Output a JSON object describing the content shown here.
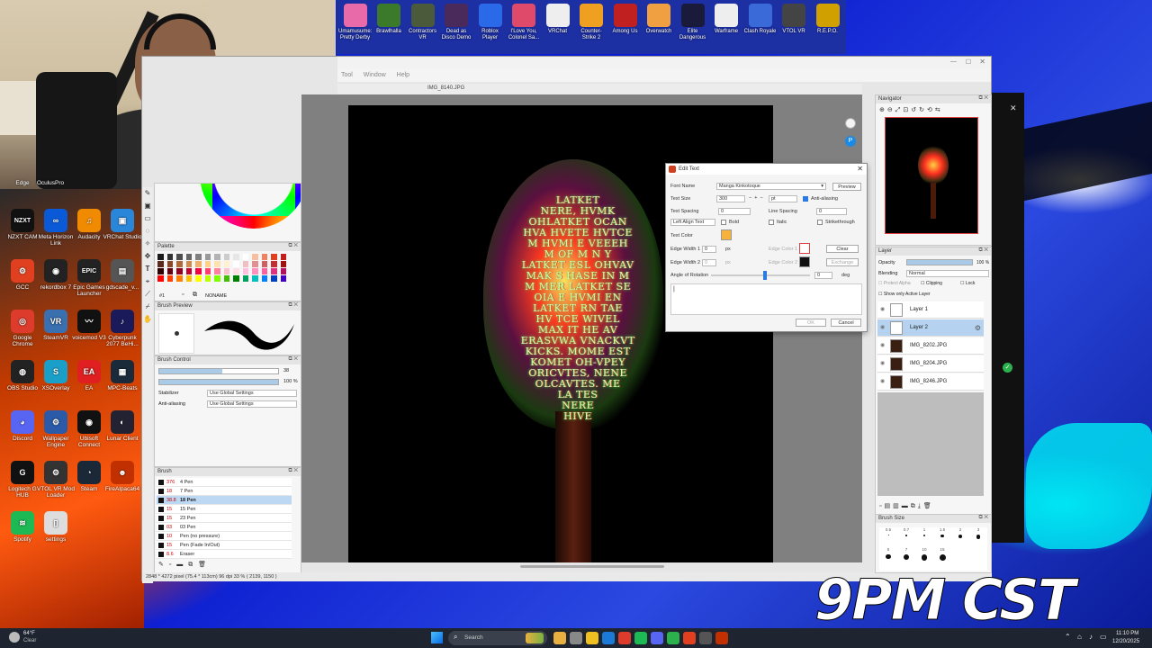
{
  "desktop": {
    "left_icons": [
      {
        "label": "Edge",
        "color": "#1a7ad6"
      },
      {
        "label": "OculusPro",
        "color": "#333333"
      },
      {
        "label": "NZXT CAM",
        "color": "#111111",
        "glyph": "NZXT"
      },
      {
        "label": "Meta Horizon Link",
        "color": "#0a5ad8",
        "glyph": "∞"
      },
      {
        "label": "Audacity",
        "color": "#f08a00",
        "glyph": "♫"
      },
      {
        "label": "VRChat Studio",
        "color": "#2a86d8",
        "glyph": "▣"
      },
      {
        "label": "GCC",
        "color": "#e04020",
        "glyph": "⚙"
      },
      {
        "label": "rekordbox 7",
        "color": "#222222",
        "glyph": "◉"
      },
      {
        "label": "Epic Games Launcher",
        "color": "#222222",
        "glyph": "EPIC"
      },
      {
        "label": "gdscade_v...",
        "color": "#555555",
        "glyph": "▤"
      },
      {
        "label": "Google Chrome",
        "color": "#dd3b2c",
        "glyph": "◎"
      },
      {
        "label": "SteamVR",
        "color": "#3a6fb0",
        "glyph": "VR"
      },
      {
        "label": "voicemod V3",
        "color": "#111111",
        "glyph": "〰"
      },
      {
        "label": "Cyberpunk 2077 BeHi...",
        "color": "#1a1a5a",
        "glyph": "♪"
      },
      {
        "label": "OBS Studio",
        "color": "#222222",
        "glyph": "◍"
      },
      {
        "label": "XSOverlay",
        "color": "#1aa0c8",
        "glyph": "S"
      },
      {
        "label": "EA",
        "color": "#e02020",
        "glyph": "EA"
      },
      {
        "label": "MPC-Beats",
        "color": "#1a2a3a",
        "glyph": "▦"
      },
      {
        "label": "Discord",
        "color": "#5865f2",
        "glyph": "◕"
      },
      {
        "label": "Wallpaper Engine",
        "color": "#2a5aa8",
        "glyph": "⚙"
      },
      {
        "label": "Ubisoft Connect",
        "color": "#111111",
        "glyph": "◉"
      },
      {
        "label": "Lunar Client",
        "color": "#222233",
        "glyph": "◐"
      },
      {
        "label": "Logitech G HUB",
        "color": "#111111",
        "glyph": "G"
      },
      {
        "label": "VTOL VR Mod Loader",
        "color": "#333333",
        "glyph": "⚙"
      },
      {
        "label": "Steam",
        "color": "#1b2838",
        "glyph": "◔"
      },
      {
        "label": "FireAlpaca64",
        "color": "#c03000",
        "glyph": "☻"
      },
      {
        "label": "Spotify",
        "color": "#1db954",
        "glyph": "≋"
      },
      {
        "label": "settings",
        "color": "#dddddd",
        "glyph": "▯"
      }
    ],
    "overlay_text": "9PM CST"
  },
  "game_bar": [
    {
      "label": "Umamusume: Pretty Derby",
      "color": "#e86aa8"
    },
    {
      "label": "Brawlhalla",
      "color": "#3a7a2a"
    },
    {
      "label": "Contractors VR",
      "color": "#4a5a3a"
    },
    {
      "label": "Dead as Disco Demo",
      "color": "#4a2a5a"
    },
    {
      "label": "Roblox Player",
      "color": "#2a6ae8"
    },
    {
      "label": "I'Love You, Colonel Sa...",
      "color": "#e04a6a"
    },
    {
      "label": "VRChat",
      "color": "#eeeeee"
    },
    {
      "label": "Counter-Strike 2",
      "color": "#f0a020"
    },
    {
      "label": "Among Us",
      "color": "#c02020"
    },
    {
      "label": "Overwatch",
      "color": "#f0a040"
    },
    {
      "label": "Elite Dangerous",
      "color": "#1a1a3a"
    },
    {
      "label": "Warframe",
      "color": "#eeeeee"
    },
    {
      "label": "Clash Royale",
      "color": "#3a6ad8"
    },
    {
      "label": "VTOL VR",
      "color": "#444444"
    },
    {
      "label": "R.E.P.O.",
      "color": "#d0a000"
    }
  ],
  "app": {
    "menus": [
      "Tool",
      "Window",
      "Help"
    ],
    "document_tab": "IMG_8140.JPG",
    "status_bar": "2848 * 4272 pixel   (75.4 * 113cm)   96 dpi   33 %   ( 2139, 1150 )",
    "artwork_lines": [
      "LATKET",
      "NERE, HVMK",
      "OHLATKET OCAN",
      "HVA HVETE HVTCE",
      "M HVMI E VEEEH",
      "M OF M N Y",
      "LATKET ESL OHVAV",
      "MAK S HASE IN M",
      "M MER LATKET SE",
      "OIA E HVMI EN",
      "LATKET RN TAE",
      "HV TCE WIVEL",
      "MAX IT HE AV",
      "ERASVWA VNACKVT",
      "KICKS. MOME EST",
      "KOMET OH-VPEY",
      "ORICVTES, NENE",
      "OLCAVTES. ME",
      "LA TES",
      "NERE",
      "HIVE"
    ],
    "palette": {
      "title": "Palette",
      "index": "#1",
      "name": "NONAME",
      "colors": [
        "#1a1a1a",
        "#333333",
        "#4d4d4d",
        "#666666",
        "#808080",
        "#999999",
        "#b3b3b3",
        "#cccccc",
        "#e6e6e6",
        "#ffffff",
        "#f6c0a0",
        "#f08060",
        "#e04020",
        "#c02020",
        "#5a2a1a",
        "#8a4a2a",
        "#b06a3a",
        "#d08a4a",
        "#f0b06a",
        "#ffd08a",
        "#ffe0b0",
        "#fff0d0",
        "#ffffff",
        "#f0c0c0",
        "#e09090",
        "#d06060",
        "#c03030",
        "#a01010",
        "#300000",
        "#600010",
        "#900020",
        "#c00030",
        "#f00040",
        "#ff4070",
        "#ff80a0",
        "#ffc0d0",
        "#ffe0e8",
        "#ffc0e0",
        "#ff90c0",
        "#ff60a0",
        "#e03080",
        "#b01060",
        "#ff0000",
        "#ff4000",
        "#ff8000",
        "#ffc000",
        "#ffff00",
        "#c0ff00",
        "#80ff00",
        "#40c000",
        "#008000",
        "#00a060",
        "#00c0c0",
        "#0080ff",
        "#0040c0",
        "#4000c0"
      ]
    },
    "brush_preview": {
      "title": "Brush Preview"
    },
    "brush_control": {
      "title": "Brush Control",
      "size_value": "38",
      "opacity_value": "100 %",
      "size_fill": 0.53,
      "opacity_fill": 1.0,
      "stabilizer_label": "Stabilizer",
      "stabilizer_value": "Use Global Settings",
      "antialiasing_label": "Anti-aliasing",
      "antialiasing_value": "Use Global Settings"
    },
    "brush_list": {
      "title": "Brush",
      "items": [
        {
          "size": "376",
          "name": "4 Pen"
        },
        {
          "size": "18",
          "name": "7 Pen"
        },
        {
          "size": "38.8",
          "name": "18 Pen",
          "selected": true
        },
        {
          "size": "15",
          "name": "15 Pen"
        },
        {
          "size": "15",
          "name": "23 Pen"
        },
        {
          "size": "03",
          "name": "03 Pen"
        },
        {
          "size": "10",
          "name": "Pen (no pressure)"
        },
        {
          "size": "15",
          "name": "Pen (Fade In/Out)"
        },
        {
          "size": "8.6",
          "name": "Eraser"
        }
      ]
    },
    "navigator": {
      "title": "Navigator"
    },
    "layer_panel": {
      "title": "Layer",
      "opacity_label": "Opacity",
      "opacity_value": "100 %",
      "opacity_fill": 1.0,
      "blending_label": "Blending",
      "blending_value": "Normal",
      "protect_alpha": "Protect Alpha",
      "clipping": "Clipping",
      "lock": "Lock",
      "show_active": "Show only Active Layer",
      "layers": [
        {
          "name": "Layer 1",
          "selected": false,
          "dark": false
        },
        {
          "name": "Layer 2",
          "selected": true,
          "dark": false
        },
        {
          "name": "IMG_8202.JPG",
          "selected": false,
          "dark": true
        },
        {
          "name": "IMG_8204.JPG",
          "selected": false,
          "dark": true
        },
        {
          "name": "IMG_8246.JPG",
          "selected": false,
          "dark": true
        }
      ]
    },
    "brush_size_panel": {
      "title": "Brush Size",
      "sizes": [
        "0.5",
        "0.7",
        "1",
        "1.5",
        "2",
        "3",
        "5",
        "7",
        "10",
        "15"
      ]
    },
    "edit_text_dialog": {
      "title": "Edit Text",
      "font_name_label": "Font Name",
      "font_name_value": "Manga Kinkotoque",
      "preview_btn": "Preview",
      "text_size_label": "Text Size",
      "text_size_value": "300",
      "text_size_unit": "pt",
      "antialiasing_label": "Anti-aliasing",
      "text_spacing_label": "Text Spacing",
      "text_spacing_value": "0",
      "line_spacing_label": "Line Spacing",
      "line_spacing_value": "0",
      "align_value": "Left Align Text",
      "bold_label": "Bold",
      "italic_label": "Italic",
      "strikethrough_label": "Strikethrough",
      "text_color_label": "Text Color",
      "text_color": "#f7b23b",
      "edge_width1_label": "Edge Width 1",
      "edge_width1_value": "0",
      "edge_width2_label": "Edge Width 2",
      "edge_width2_value": "0",
      "px_unit": "px",
      "edge_color1_label": "Edge Color 1",
      "edge_color2_label": "Edge Color 2",
      "clear_btn": "Clear",
      "exchange_btn": "Exchange",
      "rotation_label": "Angle of Rotation",
      "rotation_value": "0",
      "deg_unit": "deg",
      "text_value": "|",
      "ok_btn": "OK",
      "cancel_btn": "Cancel"
    }
  },
  "taskbar": {
    "weather_temp": "64°F",
    "weather_desc": "Clear",
    "search_placeholder": "Search",
    "time": "11:10 PM",
    "date": "12/20/2025"
  }
}
